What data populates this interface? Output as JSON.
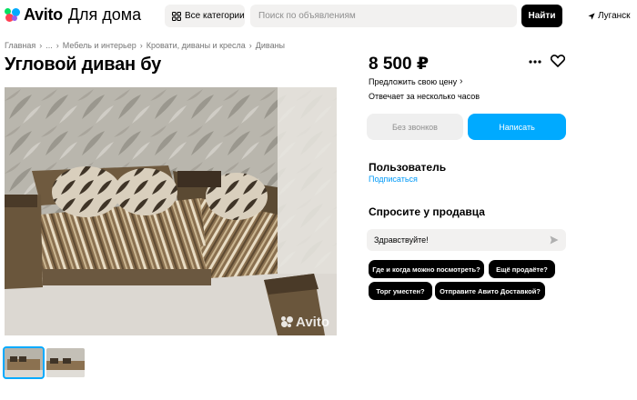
{
  "header": {
    "logo_text": "Avito",
    "logo_sub": "Для дома",
    "categories_label": "Все категории",
    "search_placeholder": "Поиск по объявлениям",
    "find_label": "Найти",
    "location": "Луганск"
  },
  "breadcrumb": [
    "Главная",
    "...",
    "Мебель и интерьер",
    "Кровати, диваны и кресла",
    "Диваны"
  ],
  "listing": {
    "title": "Угловой диван бу",
    "price": "8 500 ₽",
    "suggest_price": "Предложить свою цену",
    "response_time": "Отвечает за несколько часов",
    "no_calls_label": "Без звонков",
    "write_label": "Написать",
    "watermark": "Avito"
  },
  "seller": {
    "name": "Пользователь",
    "subscribe_label": "Подписаться"
  },
  "ask": {
    "title": "Спросите у продавца",
    "message": "Здравствуйте!",
    "chips": [
      "Где и когда можно посмотреть?",
      "Ещё продаёте?",
      "Торг уместен?",
      "Отправите Авито Доставкой?"
    ]
  },
  "colors": {
    "accent": "#00aaff",
    "button_dark": "#000000",
    "field_bg": "#f2f1f0",
    "link": "#0099f7"
  }
}
